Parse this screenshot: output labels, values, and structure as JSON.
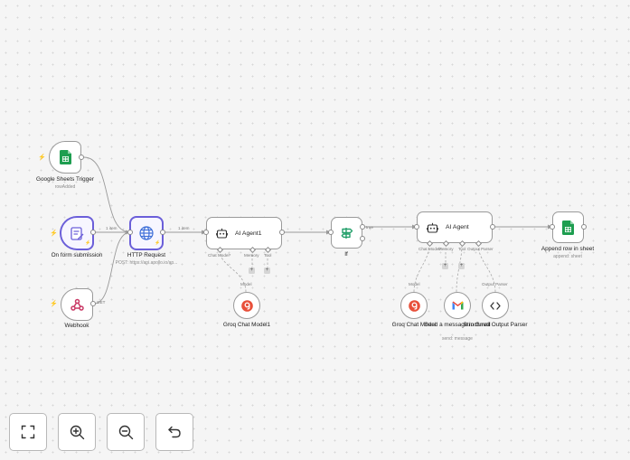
{
  "nodes": {
    "sheets_trigger": {
      "title": "Google Sheets Trigger",
      "subtitle": "rowAdded"
    },
    "form_submission": {
      "title": "On form submission"
    },
    "webhook": {
      "title": "Webhook"
    },
    "http_request": {
      "title": "HTTP Request",
      "subtitle": "POST: https://api.apollo.io/ap..."
    },
    "ai_agent1": {
      "title": "AI Agent1",
      "ports": [
        "Chat Model*",
        "Memory",
        "Tool"
      ]
    },
    "groq_model1": {
      "title": "Groq Chat Model1",
      "port_label": "Model"
    },
    "if_node": {
      "title": "If"
    },
    "ai_agent": {
      "title": "AI Agent",
      "ports": [
        "Chat Model*",
        "Memory",
        "Tool",
        "Output Parser"
      ]
    },
    "groq_model": {
      "title": "Groq Chat Model",
      "port_label": "Model"
    },
    "gmail": {
      "title": "Send a message in Gmail",
      "subtitle": "send: message"
    },
    "parser": {
      "title": "Structured Output Parser",
      "port_label": "Output Parser"
    },
    "append_row": {
      "title": "Append row in sheet",
      "subtitle": "append: sheet"
    }
  },
  "edge_labels": {
    "form_to_http": "1 item",
    "webhook_to_http": "GET",
    "http_to_agent1": "1 item",
    "if_true": "true"
  },
  "plus_symbol": "+",
  "controls": [
    {
      "name": "zoom-to-fit-button",
      "icon": "fit-view-icon"
    },
    {
      "name": "zoom-in-button",
      "icon": "zoom-in-icon"
    },
    {
      "name": "zoom-out-button",
      "icon": "zoom-out-icon"
    },
    {
      "name": "undo-button",
      "icon": "undo-icon"
    }
  ],
  "colors": {
    "accent": "#6b5fd9",
    "trigger_bolt": "#ef6b4a",
    "sheets_green": "#1e9e50",
    "http_blue": "#3f6fd8",
    "groq_red": "#e8503a",
    "if_green": "#24a06b"
  }
}
